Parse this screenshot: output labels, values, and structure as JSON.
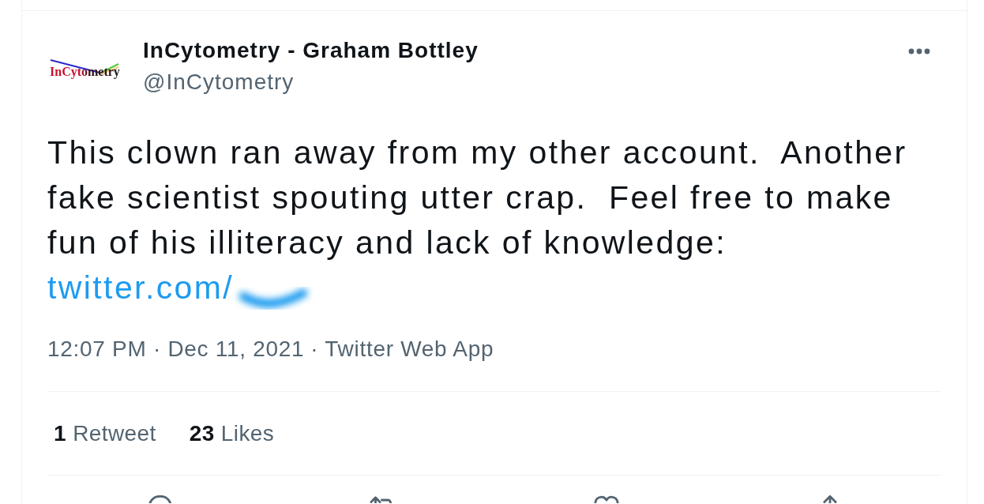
{
  "tweet": {
    "author": {
      "name": "InCytometry - Graham Bottley",
      "handle": "@InCytometry",
      "avatar_logo_text": "InCytometry"
    },
    "text": "This clown ran away from my other account.  Another fake scientist spouting utter crap.  Feel free to make fun of his illiteracy and lack of knowledge:",
    "link": {
      "text": "twitter.com/",
      "redacted": true
    },
    "timestamp": "12:07 PM · Dec 11, 2021",
    "separator": "·",
    "source": "Twitter Web App",
    "stats": [
      {
        "count": "1",
        "label": "Retweet"
      },
      {
        "count": "23",
        "label": "Likes"
      }
    ],
    "actions": [
      {
        "kind": "reply"
      },
      {
        "kind": "retweet"
      },
      {
        "kind": "like"
      },
      {
        "kind": "share"
      }
    ]
  }
}
